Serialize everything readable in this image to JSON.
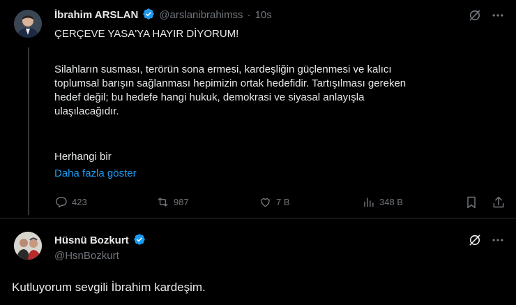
{
  "tweet": {
    "author_name": "İbrahim ARSLAN",
    "handle": "@arslanibrahimss",
    "separator": "·",
    "time": "10s",
    "headline": "ÇERÇEVE YASA'YA HAYIR DİYORUM!",
    "body_lines": [
      "Silahların susması, terörün sona ermesi, kardeşliğin güçlenmesi ve kalıcı",
      "toplumsal barışın sağlanması hepimizin ortak hedefidir. Tartışılması gereken",
      "hedef değil; bu hedefe hangi hukuk, demokrasi ve siyasal anlayışla",
      "ulaşılacağıdır."
    ],
    "trailing_text": "Herhangi bir",
    "show_more": "Daha fazla göster",
    "actions": {
      "replies": "423",
      "reposts": "987",
      "likes": "7 B",
      "views": "348 B"
    }
  },
  "reply": {
    "author_name": "Hüsnü Bozkurt",
    "handle": "@HsnBozkurt",
    "text": "Kutluyorum sevgili İbrahim kardeşim."
  },
  "colors": {
    "background": "#000000",
    "text": "#e7e9ea",
    "muted": "#71767b",
    "link": "#1d9bf0",
    "verified": "#1d9bf0"
  }
}
